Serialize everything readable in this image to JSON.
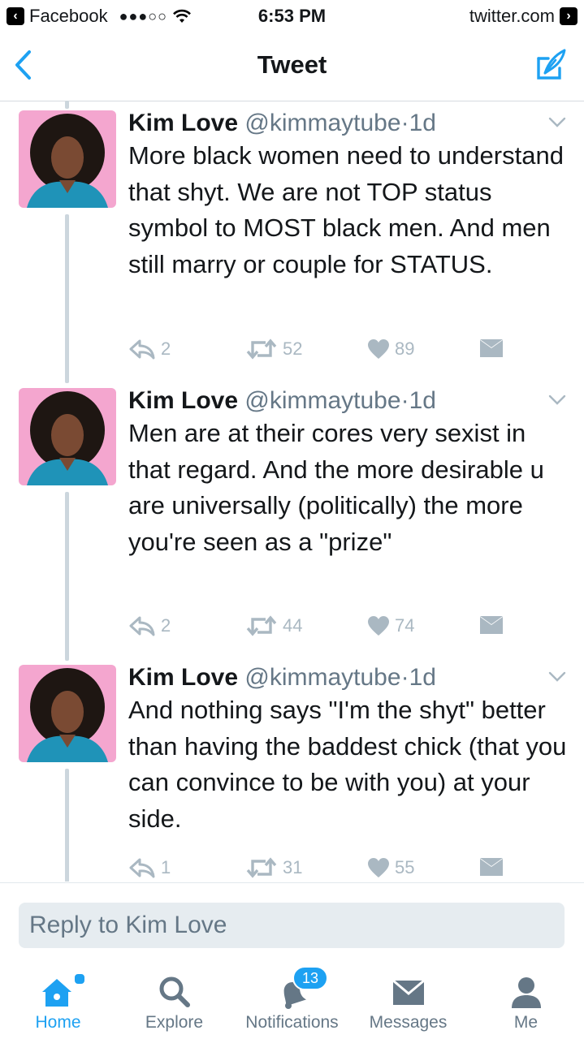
{
  "status_bar": {
    "back_app": "Facebook",
    "signal": "●●●○○",
    "time": "6:53 PM",
    "domain": "twitter.com"
  },
  "nav": {
    "title": "Tweet"
  },
  "tweets": [
    {
      "name": "Kim Love",
      "handle": "@kimmaytube",
      "separator": "·",
      "time": "1d",
      "text": "More black women need to understand that shyt. We are not TOP status symbol to MOST black men. And men still marry or couple for STATUS.",
      "replies": "2",
      "retweets": "52",
      "likes": "89"
    },
    {
      "name": "Kim Love",
      "handle": "@kimmaytube",
      "separator": "·",
      "time": "1d",
      "text": "Men are at their cores very sexist in that regard. And the more desirable u are universally (politically) the more you're seen as a \"prize\"",
      "replies": "2",
      "retweets": "44",
      "likes": "74"
    },
    {
      "name": "Kim Love",
      "handle": "@kimmaytube",
      "separator": "·",
      "time": "1d",
      "text": "And nothing says \"I'm the shyt\" better than having the baddest chick (that you can convince to be with you) at your side.",
      "replies": "1",
      "retweets": "31",
      "likes": "55"
    }
  ],
  "reply": {
    "placeholder": "Reply to Kim Love"
  },
  "tabbar": {
    "home": "Home",
    "explore": "Explore",
    "notifications": "Notifications",
    "notifications_badge": "13",
    "messages": "Messages",
    "me": "Me"
  },
  "colors": {
    "accent": "#1da1f2",
    "text": "#14171a",
    "secondary": "#657786",
    "action_gray": "#aab8c2",
    "thread_line": "#ccd6dd",
    "avatar_bg": "#f4a6cf"
  }
}
